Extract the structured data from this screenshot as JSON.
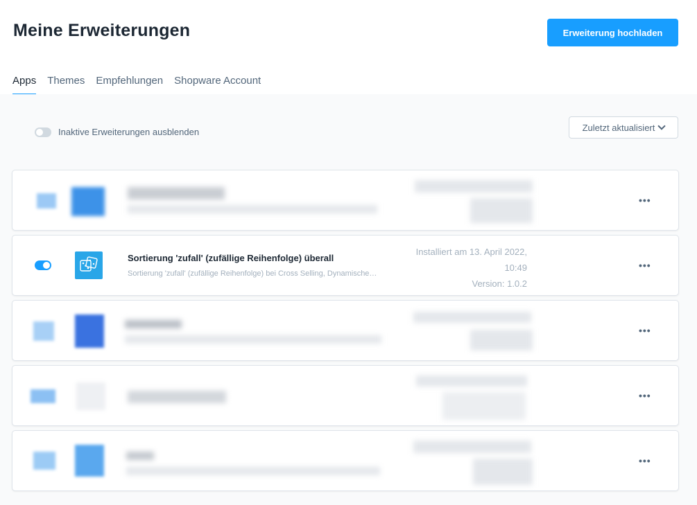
{
  "page": {
    "title": "Meine Erweiterungen",
    "upload_button": "Erweiterung hochladen"
  },
  "tabs": [
    {
      "label": "Apps",
      "active": true
    },
    {
      "label": "Themes",
      "active": false
    },
    {
      "label": "Empfehlungen",
      "active": false
    },
    {
      "label": "Shopware Account",
      "active": false
    }
  ],
  "filters": {
    "hide_inactive_label": "Inaktive Erweiterungen ausblenden",
    "hide_inactive_enabled": false,
    "sort_label": "Zuletzt aktualisiert"
  },
  "extensions": [
    {
      "obscured": true
    },
    {
      "obscured": false,
      "active": true,
      "name": "Sortierung 'zufall' (zufällige Reihenfolge) überall",
      "description": "Sortierung 'zufall' (zufällige Reihenfolge) bei Cross Selling, Dynamische…",
      "installed_line1": "Installiert am 13. April 2022,",
      "installed_line2": "10:49",
      "version": "Version: 1.0.2",
      "icon": "dice-icon"
    },
    {
      "obscured": true
    },
    {
      "obscured": true
    },
    {
      "obscured": true
    }
  ],
  "menu_glyph": "•••",
  "colors": {
    "accent": "#189eff",
    "text_dark": "#1c2733",
    "text_muted": "#52667a",
    "text_light": "#a3b0bd",
    "background": "#f9fafb"
  }
}
